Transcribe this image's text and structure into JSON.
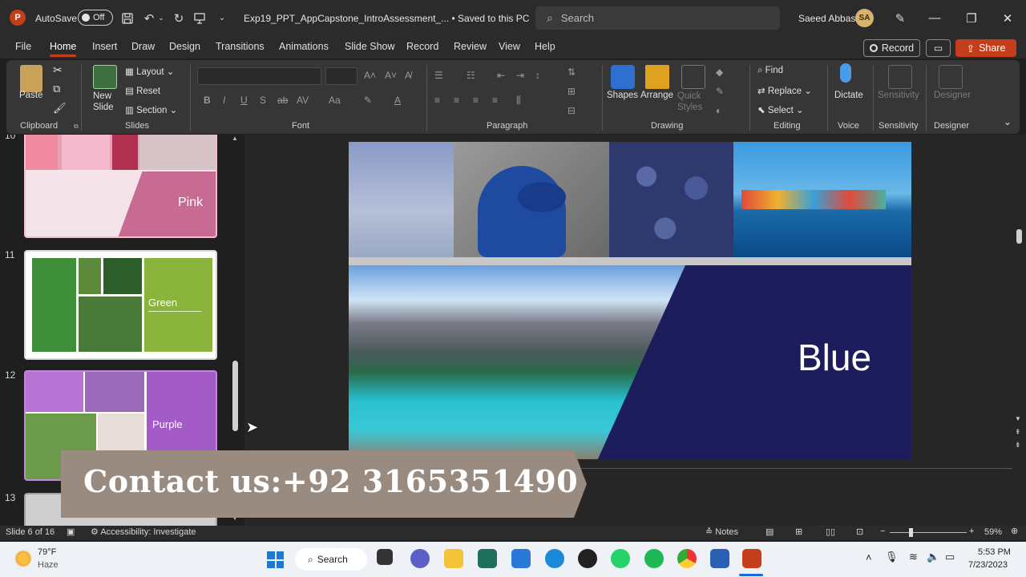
{
  "titlebar": {
    "autosave_label": "AutoSave",
    "autosave_state": "Off",
    "doc_title": "Exp19_PPT_AppCapstone_IntroAssessment_...  •  Saved to this PC",
    "search_placeholder": "Search",
    "user_name": "Saeed Abbas",
    "user_initials": "SA"
  },
  "menu": {
    "tabs": [
      "File",
      "Home",
      "Insert",
      "Draw",
      "Design",
      "Transitions",
      "Animations",
      "Slide Show",
      "Record",
      "Review",
      "View",
      "Help"
    ],
    "active": "Home",
    "record_label": "Record",
    "share_label": "Share"
  },
  "ribbon": {
    "clipboard": {
      "paste": "Paste",
      "label": "Clipboard"
    },
    "slides": {
      "new_slide": "New\nSlide",
      "layout": "Layout",
      "reset": "Reset",
      "section": "Section",
      "label": "Slides"
    },
    "font": {
      "label": "Font"
    },
    "paragraph": {
      "label": "Paragraph"
    },
    "drawing": {
      "shapes": "Shapes",
      "arrange": "Arrange",
      "quick_styles": "Quick Styles",
      "label": "Drawing"
    },
    "editing": {
      "find": "Find",
      "replace": "Replace",
      "select": "Select",
      "label": "Editing"
    },
    "voice": {
      "dictate": "Dictate",
      "label": "Voice"
    },
    "sensitivity": {
      "button": "Sensitivity",
      "label": "Sensitivity"
    },
    "designer": {
      "button": "Designer",
      "label": "Designer"
    }
  },
  "thumbnails": [
    {
      "number": "10",
      "label": "Pink"
    },
    {
      "number": "11",
      "label": "Green"
    },
    {
      "number": "12",
      "label": "Purple"
    },
    {
      "number": "13",
      "label": ""
    }
  ],
  "slide": {
    "title": "Blue"
  },
  "overlay": {
    "contact_text": "Contact us:+92 3165351490"
  },
  "status": {
    "slide_info": "Slide 6 of 16",
    "accessibility": "Accessibility: Investigate",
    "notes": "Notes",
    "zoom": "59%"
  },
  "taskbar": {
    "weather_temp": "79°F",
    "weather_desc": "Haze",
    "search_label": "Search",
    "time": "5:53 PM",
    "date": "7/23/2023"
  },
  "colors": {
    "accent": "#c43e1c",
    "slide_blue": "#1d1d5e",
    "green": "#8ab43c",
    "purple": "#a35bc8",
    "pink": "#c86b92"
  }
}
